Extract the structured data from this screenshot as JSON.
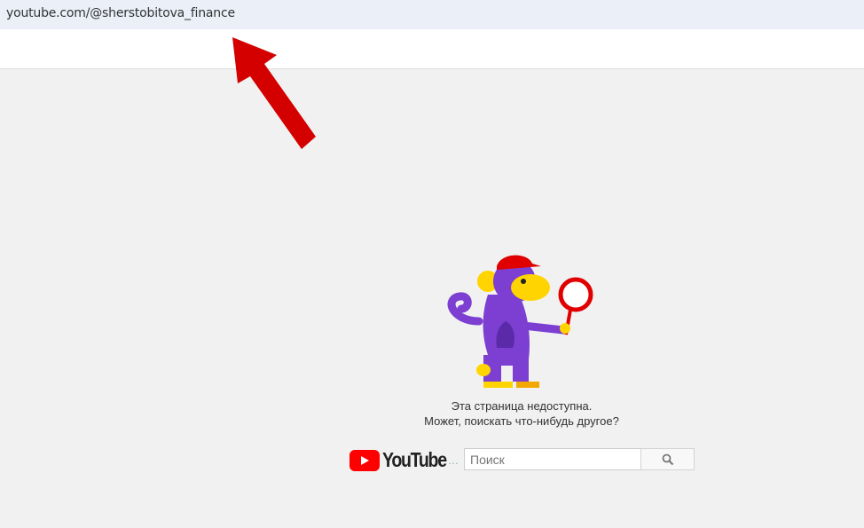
{
  "address_bar": {
    "url": "youtube.com/@sherstobitova_finance"
  },
  "error": {
    "line1": "Эта страница недоступна.",
    "line2": "Может, поискать что-нибудь другое?"
  },
  "logo": {
    "text": "YouTube"
  },
  "search": {
    "placeholder": "Поиск"
  },
  "colors": {
    "arrow": "#d40000",
    "logo_red": "#ff0000",
    "monkey": "#7c3fd1"
  }
}
